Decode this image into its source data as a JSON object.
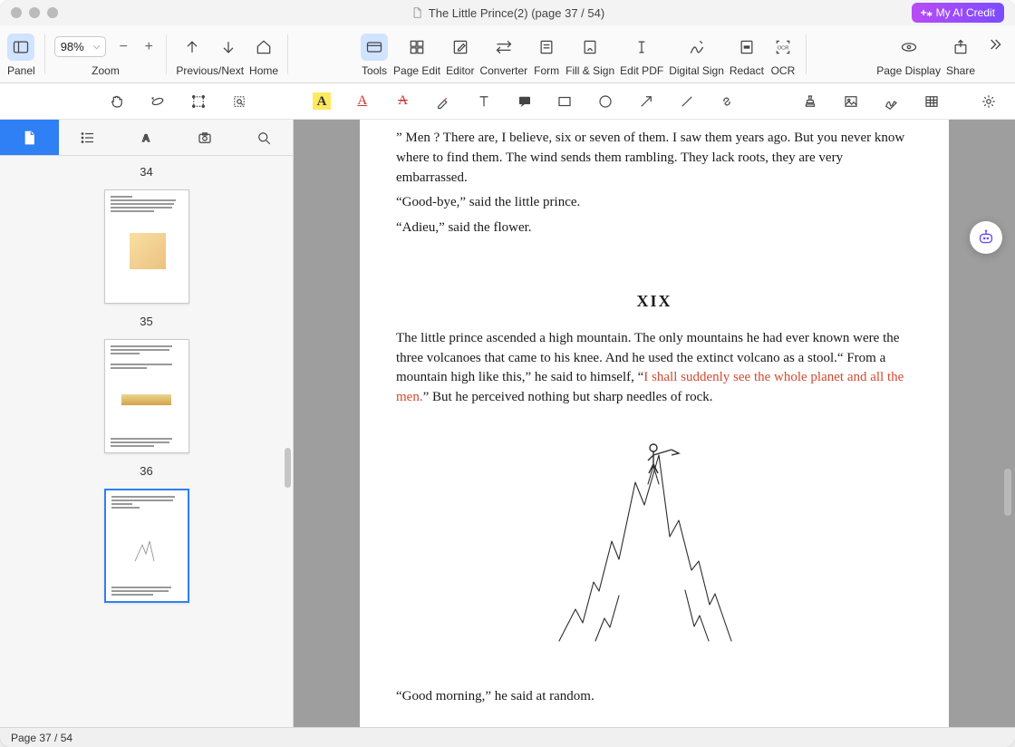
{
  "titlebar": {
    "title": "The Little Prince(2) (page 37 / 54)",
    "ai_credit_label": "My AI Credit"
  },
  "toolbar": {
    "panel_label": "Panel",
    "zoom_label": "Zoom",
    "zoom_value": "98%",
    "prev_next_label": "Previous/Next",
    "home_label": "Home",
    "tools_label": "Tools",
    "page_edit_label": "Page Edit",
    "editor_label": "Editor",
    "converter_label": "Converter",
    "form_label": "Form",
    "fill_sign_label": "Fill & Sign",
    "edit_pdf_label": "Edit PDF",
    "digital_sign_label": "Digital Sign",
    "redact_label": "Redact",
    "ocr_label": "OCR",
    "page_display_label": "Page Display",
    "share_label": "Share"
  },
  "annotate": {
    "highlight_glyph": "A",
    "underline_glyph": "A"
  },
  "sidebar": {
    "thumbs": [
      {
        "number": "34"
      },
      {
        "number": "35"
      },
      {
        "number": "36"
      }
    ]
  },
  "document": {
    "carry_para": "” Men ? There are, I believe, six or seven of them. I saw them years ago. But you never know where to find them. The wind sends them rambling. They lack roots, they are very embarrassed.",
    "goodbye_line": "“Good-bye,” said the little prince.",
    "adieu_line": "“Adieu,” said the flower.",
    "chapter_heading": "XIX",
    "chapter_para_before_red": "The little prince ascended a high mountain. The only mountains he had ever known were the three volcanoes that came to his knee. And he used the extinct volcano as a stool.“ From a mountain high like this,” he said to himself, “",
    "chapter_para_red": "I shall suddenly see the whole planet and all the men.",
    "chapter_para_after_red": "” But he perceived nothing but sharp needles of rock.",
    "good_morning": "“Good morning,” he said at random."
  },
  "statusbar": {
    "page_indicator": "Page 37 / 54"
  }
}
